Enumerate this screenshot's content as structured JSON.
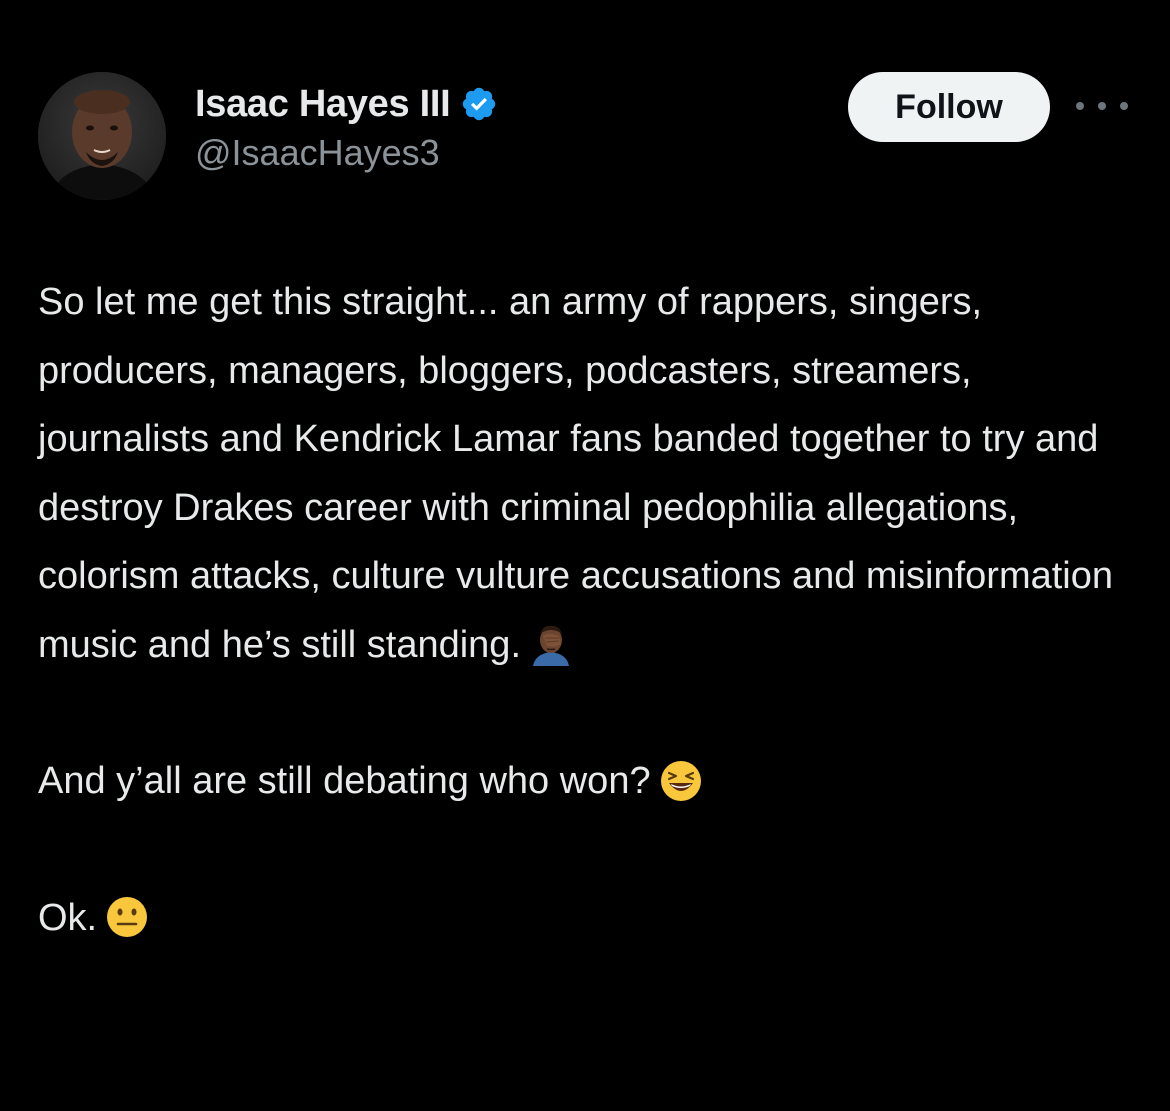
{
  "author": {
    "display_name": "Isaac Hayes III",
    "handle": "@IsaacHayes3",
    "verified": true
  },
  "actions": {
    "follow_label": "Follow",
    "more_icon": "more-horizontal-icon"
  },
  "tweet": {
    "paragraph_1": "So let me get this straight... an army of rappers, singers, producers, managers, bloggers, podcasters, streamers, journalists and Kendrick Lamar fans banded together to try and destroy Drakes career with criminal pedophilia allegations, colorism attacks, culture vulture accusations and misinformation music and he’s still standing.",
    "paragraph_1_emoji": "face-palm-emoji",
    "paragraph_2": "And y’all are still debating who won?",
    "paragraph_2_emoji": "grinning-squinting-face-emoji",
    "paragraph_3": "Ok.",
    "paragraph_3_emoji": "neutral-face-emoji"
  },
  "colors": {
    "background": "#000000",
    "text": "#e7e9ea",
    "secondary_text": "#8b9298",
    "verified_badge": "#1d9bf0",
    "follow_button_bg": "#eff3f4"
  }
}
